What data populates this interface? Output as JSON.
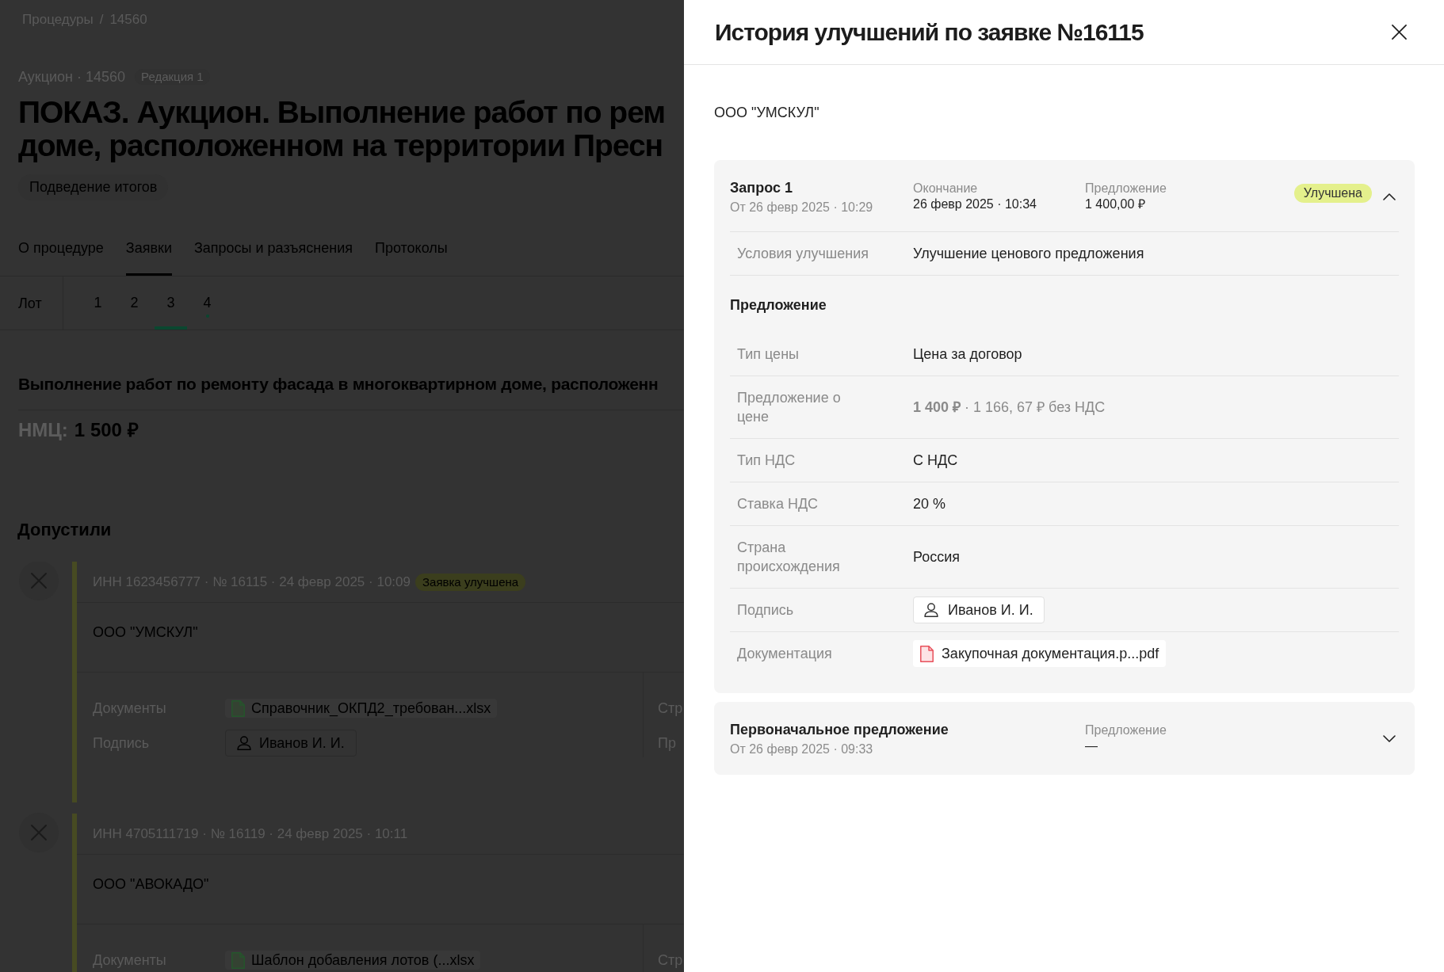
{
  "page": {
    "breadcrumb": {
      "items": [
        "Процедуры",
        "14560"
      ],
      "separator": "/"
    },
    "procedure": {
      "meta": "Аукцион · 14560",
      "edition": "Редакция 1",
      "title_lines": [
        "ПОКАЗ. Аукцион. Выполнение работ по рем",
        "доме, расположенном на территории Пресн"
      ],
      "status": "Подведение итогов"
    },
    "tabs": [
      {
        "label": "О процедуре",
        "selected": false
      },
      {
        "label": "Заявки",
        "selected": true
      },
      {
        "label": "Запросы и разъяснения",
        "selected": false
      },
      {
        "label": "Протоколы",
        "selected": false
      }
    ],
    "lots": {
      "label": "Лот",
      "items": [
        {
          "label": "1",
          "selected": false,
          "marked": false
        },
        {
          "label": "2",
          "selected": false,
          "marked": false
        },
        {
          "label": "3",
          "selected": true,
          "marked": false
        },
        {
          "label": "4",
          "selected": false,
          "marked": true
        }
      ]
    },
    "lot_title": "Выполнение работ по ремонту фасада в многоквартирном доме, расположенн",
    "nmc": {
      "label": "НМЦ:",
      "value": "1 500 ₽"
    },
    "section_title": "Допустили",
    "applications": [
      {
        "header": "ИНН 1623456777 · № 16115 · 24 февр 2025 · 10:09",
        "badge": "Заявка улучшена",
        "company": "ООО \"УМСКУЛ\"",
        "details": [
          {
            "label": "Документы",
            "kind": "file",
            "value": "Справочник_ОКПД2_требован...xlsx"
          },
          {
            "label": "Подпись",
            "kind": "person",
            "value": "Иванов И. И."
          }
        ],
        "side_labels": [
          "Стр",
          "Пр"
        ]
      },
      {
        "header": "ИНН 4705111719 · № 16119 · 24 февр 2025 · 10:11",
        "company": "ООО \"АВОКАДО\"",
        "details": [
          {
            "label": "Документы",
            "kind": "file",
            "value": "Шаблон добавления лотов (...xlsx"
          }
        ],
        "side_labels": [
          "Стр"
        ]
      }
    ]
  },
  "drawer": {
    "title": "История улучшений по заявке №16115",
    "company": "ООО \"УМСКУЛ\"",
    "requests": [
      {
        "title": "Запрос 1",
        "date": "От 26 февр 2025 · 10:29",
        "columns": [
          {
            "label": "Окончание",
            "value": "26 февр 2025 · 10:34"
          },
          {
            "label": "Предложение",
            "value": "1 400,00 ₽"
          }
        ],
        "badge": "Улучшена",
        "expanded": true,
        "sections": [
          {
            "rows": [
              {
                "kind": "text",
                "label": "Условия улучшения",
                "value": "Улучшение ценового предложения"
              }
            ]
          },
          {
            "title": "Предложение",
            "rows": [
              {
                "kind": "text",
                "label": "Тип цены",
                "value": "Цена за договор"
              },
              {
                "kind": "price",
                "label": "Предложение о цене",
                "value": "**1 400 ₽** · 1 166, 67 ₽ без НДС"
              },
              {
                "kind": "text",
                "label": "Тип НДС",
                "value": "С НДС"
              },
              {
                "kind": "text",
                "label": "Ставка НДС",
                "value": "20 %"
              },
              {
                "kind": "text",
                "label": "Страна происхождения",
                "value": "Россия"
              },
              {
                "kind": "person",
                "label": "Подпись",
                "value": "Иванов И. И."
              },
              {
                "kind": "file",
                "label": "Документация",
                "value": "Закупочная документация.р...pdf"
              }
            ]
          }
        ]
      },
      {
        "title": "Первоначальное предложение",
        "date": "От 26 февр 2025 · 09:33",
        "columns": [
          {
            "label": "Предложение",
            "value": "—"
          }
        ],
        "expanded": false
      }
    ]
  }
}
